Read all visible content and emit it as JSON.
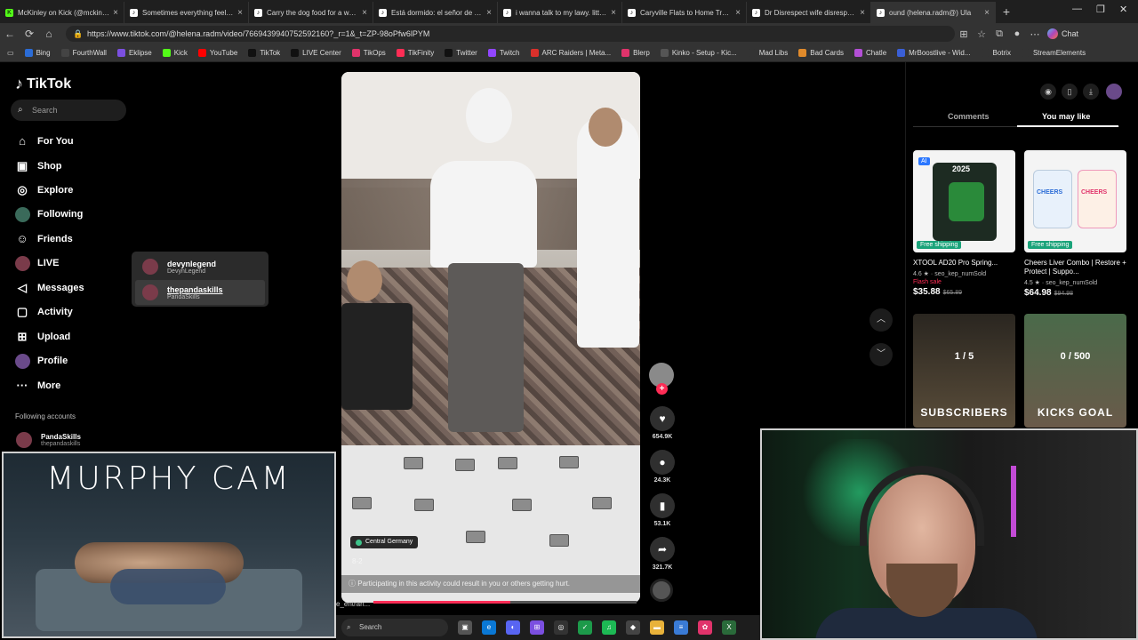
{
  "browser": {
    "tabs": [
      {
        "title": "McKinley on Kick (@mckinley.tv",
        "icon": "kick-icon",
        "active": false
      },
      {
        "title": "Sometimes everything feels too",
        "icon": "tiktok-icon",
        "active": false
      },
      {
        "title": "Carry the dog food for a woman",
        "icon": "tiktok-icon",
        "active": false
      },
      {
        "title": "Está dormido: el señor de los ladr",
        "icon": "tiktok-icon",
        "active": false
      },
      {
        "title": "i wanna talk to my lawy. little li",
        "icon": "tiktok-icon",
        "active": false
      },
      {
        "title": "Caryville Flats to Home Trail Rid",
        "icon": "tiktok-icon",
        "active": false
      },
      {
        "title": "Dr Disrespect wife disrespected",
        "icon": "tiktok-icon",
        "active": false
      },
      {
        "title": "ound (helena.radm@) Ula",
        "icon": "tiktok-icon",
        "active": true
      }
    ],
    "new_tab": "+",
    "url": "https://www.tiktok.com/@helena.radm/video/7669439940752592160?_r=1&_t=ZP-98oPfw6lPYM",
    "chat_label": "Chat",
    "bookmarks": [
      {
        "label": "Bing",
        "color": "#2b6cd6"
      },
      {
        "label": "FourthWall",
        "color": "#444"
      },
      {
        "label": "Eklipse",
        "color": "#7b4fe0"
      },
      {
        "label": "Kick",
        "color": "#53fc18"
      },
      {
        "label": "YouTube",
        "color": "#ff0000"
      },
      {
        "label": "TikTok",
        "color": "#111"
      },
      {
        "label": "LIVE Center",
        "color": "#111"
      },
      {
        "label": "TikOps",
        "color": "#e0336b"
      },
      {
        "label": "TikFinity",
        "color": "#ff2d55"
      },
      {
        "label": "Twitter",
        "color": "#111"
      },
      {
        "label": "Twitch",
        "color": "#9146ff"
      },
      {
        "label": "ARC Raiders | Meta...",
        "color": "#d9302b"
      },
      {
        "label": "Blerp",
        "color": "#e0336b"
      },
      {
        "label": "Kinko - Setup - Kic...",
        "color": "#555"
      },
      {
        "label": "Mad Libs",
        "color": "#333"
      },
      {
        "label": "Bad Cards",
        "color": "#e08a2b"
      },
      {
        "label": "Chatle",
        "color": "#b34fd6"
      },
      {
        "label": "MrBoostlive - Wid...",
        "color": "#3a5fd6"
      },
      {
        "label": "Botrix",
        "color": "#333"
      },
      {
        "label": "StreamElements",
        "color": "#333"
      }
    ]
  },
  "tiktok": {
    "logo": "TikTok",
    "search_placeholder": "Search",
    "nav": [
      {
        "label": "For You",
        "icon": "home-icon"
      },
      {
        "label": "Shop",
        "icon": "shop-icon"
      },
      {
        "label": "Explore",
        "icon": "compass-icon"
      },
      {
        "label": "Following",
        "icon": "following-avatar"
      },
      {
        "label": "Friends",
        "icon": "friends-icon"
      },
      {
        "label": "LIVE",
        "icon": "live-avatar"
      },
      {
        "label": "Messages",
        "icon": "messages-icon"
      },
      {
        "label": "Activity",
        "icon": "activity-icon"
      },
      {
        "label": "Upload",
        "icon": "upload-icon"
      },
      {
        "label": "Profile",
        "icon": "profile-avatar"
      },
      {
        "label": "More",
        "icon": "more-icon"
      }
    ],
    "following_header": "Following accounts",
    "following_accounts": [
      {
        "name": "PandaSkills",
        "handle": "thepandaskills"
      }
    ],
    "popup": [
      {
        "name": "devynlegend",
        "handle": "DevynLegend",
        "highlighted": false
      },
      {
        "name": "thepandaskills",
        "handle": "PandaSkills",
        "highlighted": true
      }
    ],
    "video": {
      "location": "Central Germany",
      "date": "8-2",
      "warning": "Participating in this activity could result in you or others getting hurt.",
      "progress": 0.52
    },
    "actions": [
      {
        "icon": "heart-icon",
        "count": "654.9K"
      },
      {
        "icon": "comment-icon",
        "count": "24.3K"
      },
      {
        "icon": "bookmark-icon",
        "count": "53.1K"
      },
      {
        "icon": "share-icon",
        "count": "321.7K"
      }
    ],
    "right_panel": {
      "tabs": [
        "Comments",
        "You may like"
      ],
      "active_tab": "You may like",
      "products": [
        {
          "title": "XTOOL AD20 Pro Spring...",
          "rating": "4.6 ★",
          "sold": "seo_kep_numSold",
          "flash": "Flash sale",
          "price": "$35.88",
          "old_price": "$65.89",
          "badge": "Free shipping",
          "ai": "AI",
          "box_text": "2025"
        },
        {
          "title": "Cheers Liver Combo | Restore + Protect | Suppo...",
          "rating": "4.5 ★",
          "sold": "seo_kep_numSold",
          "flash": "",
          "price": "$64.98",
          "old_price": "$94.98",
          "badge": "Free shipping",
          "ai": "",
          "box_text": "CHEERS"
        }
      ],
      "video_cards": [
        {
          "counter": "1 / 5",
          "bottom": "SUBSCRIBERS"
        },
        {
          "counter": "0 / 500",
          "bottom": "KICKS GOAL"
        }
      ]
    }
  },
  "overlays": {
    "murphy_cam_title": "MURPHY CAM",
    "taskbar_search": "Search",
    "taskbar_text": "e_entran..."
  }
}
